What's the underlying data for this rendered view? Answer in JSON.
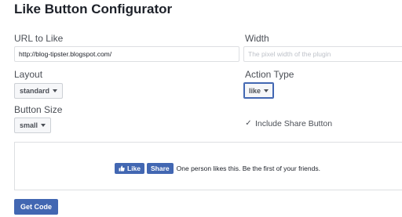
{
  "page": {
    "title": "Like Button Configurator"
  },
  "form": {
    "url": {
      "label": "URL to Like",
      "value": "http://blog-tipster.blogspot.com/"
    },
    "width": {
      "label": "Width",
      "value": "",
      "placeholder": "The pixel width of the plugin"
    },
    "layout": {
      "label": "Layout",
      "selected": "standard"
    },
    "action_type": {
      "label": "Action Type",
      "selected": "like"
    },
    "button_size": {
      "label": "Button Size",
      "selected": "small"
    },
    "include_share": {
      "label": "Include Share Button",
      "checked": true
    }
  },
  "preview": {
    "like_label": "Like",
    "share_label": "Share",
    "social_text": "One person likes this. Be the first of your friends."
  },
  "actions": {
    "get_code_label": "Get Code"
  },
  "colors": {
    "brand_blue": "#4267b2",
    "text": "#1d2129",
    "muted": "#4b4f56",
    "border": "#dddfe2"
  }
}
